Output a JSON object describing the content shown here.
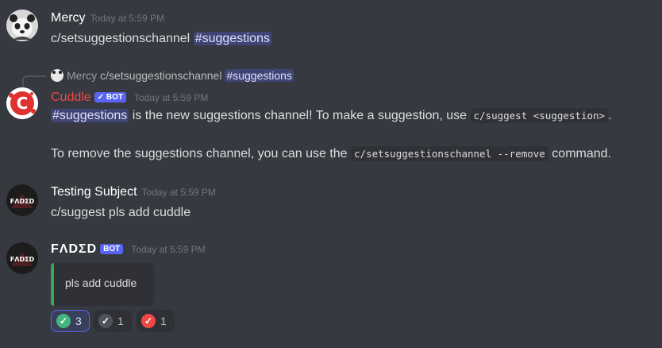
{
  "messages": {
    "m1": {
      "author": "Mercy",
      "time": "Today at 5:59 PM",
      "command": "c/setsuggestionschannel",
      "mention": "#suggestions"
    },
    "m2": {
      "reply_author": "Mercy",
      "reply_text": "c/setsuggestionschannel",
      "reply_mention": "#suggestions",
      "author": "Cuddle",
      "bot_label": "✓ BOT",
      "time": "Today at 5:59 PM",
      "line1_mention": "#suggestions",
      "line1_text": " is the new suggestions channel! To make a suggestion, use ",
      "line1_code": "c/suggest <suggestion>",
      "line1_end": ".",
      "line2_text": "To remove the suggestions channel, you can use the ",
      "line2_code": "c/setsuggestionschannel --remove",
      "line2_end": " command."
    },
    "m3": {
      "author": "Testing Subject",
      "time": "Today at 5:59 PM",
      "text": "c/suggest pls add cuddle",
      "avatar_text": "FΛDΣD"
    },
    "m4": {
      "author": "FΛDΣD",
      "bot_label": "BOT",
      "time": "Today at 5:59 PM",
      "embed_text": "pls add cuddle",
      "avatar_text": "FΛDΣD"
    }
  },
  "reactions": [
    {
      "icon": "green-check-icon",
      "count": "3",
      "color": "#43b581"
    },
    {
      "icon": "grey-check-icon",
      "count": "1",
      "color": "#4f545c"
    },
    {
      "icon": "red-check-icon",
      "count": "1",
      "color": "#f04747"
    }
  ]
}
